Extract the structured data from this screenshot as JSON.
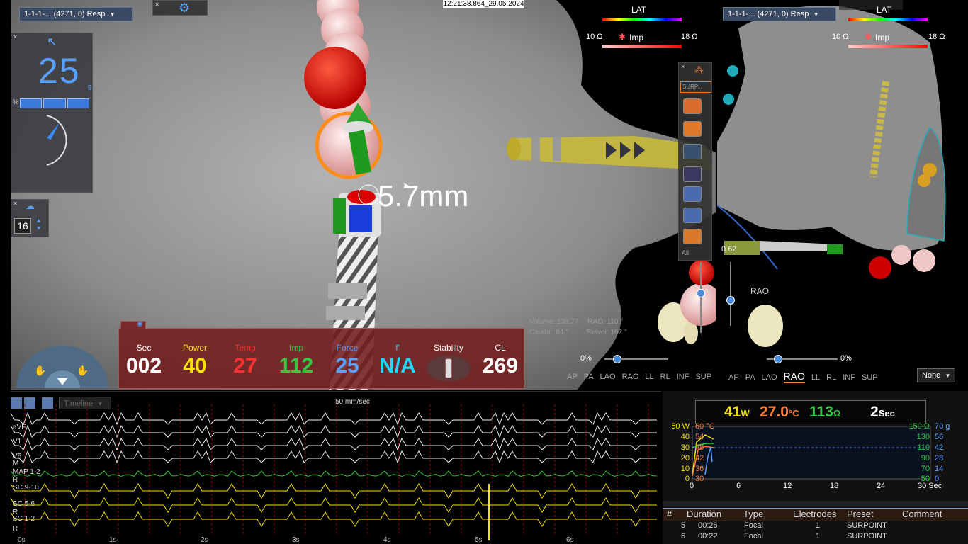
{
  "timestamp": "12:21:38.864_29.05.2024",
  "map_selector": {
    "label": "1-1-1-... (4271, 0) Resp"
  },
  "map_selector_side": {
    "label": "1-1-1-... (4271, 0) Resp"
  },
  "force_widget": {
    "value": "25",
    "unit": "g",
    "pct_label": "%"
  },
  "rate_widget": {
    "value": "16"
  },
  "distance_label": "5.7mm",
  "legend_main": {
    "lat_label": "LAT",
    "imp_label": "Imp",
    "imp_min": "10 Ω",
    "imp_max": "18 Ω"
  },
  "legend_side": {
    "lat_label": "LAT",
    "imp_label": "Imp",
    "imp_min": "10 Ω",
    "imp_max": "18 Ω"
  },
  "tool_column": {
    "surface_label": "SURP...",
    "all_label": "All"
  },
  "view_info": {
    "volume_label": "Volume:",
    "volume_value": "138.77",
    "rao_label": "RAO:",
    "rao_value": "110 °",
    "caudal_label": "Caudal:",
    "caudal_value": "84 °",
    "swivel_label": "Swivel:",
    "swivel_value": "162 °"
  },
  "stats": [
    {
      "label": "Sec",
      "value": "002",
      "label_color": "#ffffff",
      "value_color": "#ffffff"
    },
    {
      "label": "Power",
      "value": "40",
      "label_color": "#f5e100",
      "value_color": "#f5e100"
    },
    {
      "label": "Temp",
      "value": "27",
      "label_color": "#ff3030",
      "value_color": "#ff3030"
    },
    {
      "label": "Imp",
      "value": "112",
      "label_color": "#2ecc40",
      "value_color": "#2ecc40"
    },
    {
      "label": "Force",
      "value": "25",
      "label_color": "#5aa0ff",
      "value_color": "#5aa0ff"
    },
    {
      "label": "f'",
      "value": "N/A",
      "label_color": "#20d8ff",
      "value_color": "#20d8ff"
    },
    {
      "label": "Stability",
      "value": "",
      "label_color": "#ffffff",
      "value_color": "#ffffff"
    },
    {
      "label": "CL",
      "value": "269",
      "label_color": "#ffffff",
      "value_color": "#ffffff"
    }
  ],
  "zoom_main": "0%",
  "zoom_side": "0%",
  "side_value": "0.62",
  "side_view_label": "RAO",
  "view_buttons_main": [
    "AP",
    "PA",
    "LAO",
    "RAO",
    "LL",
    "RL",
    "INF",
    "SUP"
  ],
  "view_buttons_side": [
    "AP",
    "PA",
    "LAO",
    "RAO",
    "LL",
    "RL",
    "INF",
    "SUP"
  ],
  "view_selected": "RAO",
  "none_select": {
    "label": "None"
  },
  "ecg": {
    "timeline_label": "Timeline",
    "speed_label": "50 mm/sec",
    "leads": [
      "aVF",
      "V1",
      "V6",
      "MAP 1-2",
      "SC 9-10",
      "SC 5-6",
      "SC 1-2"
    ],
    "side_marks": [
      "M",
      "R",
      "R",
      "R"
    ],
    "time_ticks": [
      "0s",
      "1s",
      "2s",
      "3s",
      "4s",
      "5s",
      "6s"
    ]
  },
  "ablation": {
    "power": "41",
    "power_unit": "W",
    "temp": "27.0",
    "temp_unit": "°C",
    "imp": "113",
    "imp_unit": "Ω",
    "time": "2",
    "time_unit": "Sec",
    "power_axis": [
      "50 W",
      "40",
      "30",
      "20",
      "10",
      "0"
    ],
    "temp_axis": [
      "60 °C",
      "54",
      "48",
      "42",
      "36",
      "30"
    ],
    "imp_axis": [
      "150 Ω",
      "130",
      "110",
      "90",
      "70",
      "50"
    ],
    "force_axis": [
      "70 g",
      "56",
      "42",
      "28",
      "14",
      "0"
    ],
    "x_axis": [
      "0",
      "6",
      "12",
      "18",
      "24",
      "30 Sec"
    ]
  },
  "lesion_table": {
    "headers": [
      "#",
      "Duration",
      "Type",
      "Electrodes",
      "Preset",
      "Comment"
    ],
    "rows": [
      [
        "5",
        "00:26",
        "Focal",
        "1",
        "SURPOINT",
        ""
      ],
      [
        "6",
        "00:22",
        "Focal",
        "1",
        "SURPOINT",
        ""
      ]
    ]
  },
  "colors": {
    "power": "#f5e100",
    "temp": "#ff7a30",
    "imp": "#2ecc40",
    "force": "#5aa0ff",
    "accent": "#e88030"
  }
}
